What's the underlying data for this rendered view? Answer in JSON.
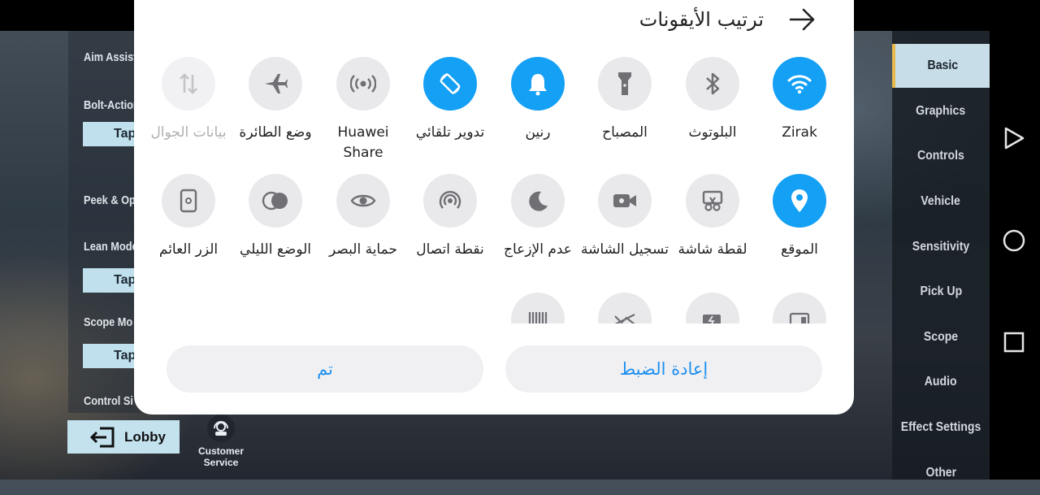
{
  "dialog": {
    "title": "ترتيب الأيقونات",
    "tiles_row1": [
      {
        "label": "Zirak",
        "icon": "wifi-icon",
        "active": true
      },
      {
        "label": "البلوتوث",
        "icon": "bluetooth-icon",
        "active": false
      },
      {
        "label": "المصباح",
        "icon": "flashlight-icon",
        "active": false
      },
      {
        "label": "رنين",
        "icon": "bell-icon",
        "active": true
      },
      {
        "label": "تدوير تلقائي",
        "icon": "auto-rotate-icon",
        "active": true
      },
      {
        "label": "Huawei Share",
        "icon": "huawei-share-icon",
        "active": false
      },
      {
        "label": "وضع الطائرة",
        "icon": "airplane-icon",
        "active": false
      },
      {
        "label": "بيانات الجوال",
        "icon": "mobile-data-icon",
        "active": false,
        "disabled": true
      }
    ],
    "tiles_row2": [
      {
        "label": "الموقع",
        "icon": "location-icon",
        "active": true
      },
      {
        "label": "لقطة شاشة",
        "icon": "screenshot-icon",
        "active": false
      },
      {
        "label": "تسجيل الشاشة",
        "icon": "screen-record-icon",
        "active": false
      },
      {
        "label": "عدم الإزعاج",
        "icon": "moon-icon",
        "active": false
      },
      {
        "label": "نقطة اتصال",
        "icon": "hotspot-icon",
        "active": false
      },
      {
        "label": "حماية البصر",
        "icon": "eye-icon",
        "active": false
      },
      {
        "label": "الوضع الليلي",
        "icon": "dark-mode-icon",
        "active": false
      },
      {
        "label": "الزر العائم",
        "icon": "floating-button-icon",
        "active": false
      }
    ],
    "reset_label": "إعادة الضبط",
    "done_label": "تم",
    "accent_color": "#14a0f5"
  },
  "game": {
    "left_labels": [
      "Aim Assist",
      "Bolt-Action",
      "Peek & Op",
      "Lean Mode",
      "Scope Mo",
      "Control Si"
    ],
    "tap_label": "Tap",
    "lobby_label": "Lobby",
    "customer_service_label": "Customer Service",
    "menu": [
      "Basic",
      "Graphics",
      "Controls",
      "Vehicle",
      "Sensitivity",
      "Pick Up",
      "Scope",
      "Audio",
      "Effect Settings",
      "Other"
    ],
    "active_menu": "Basic"
  }
}
